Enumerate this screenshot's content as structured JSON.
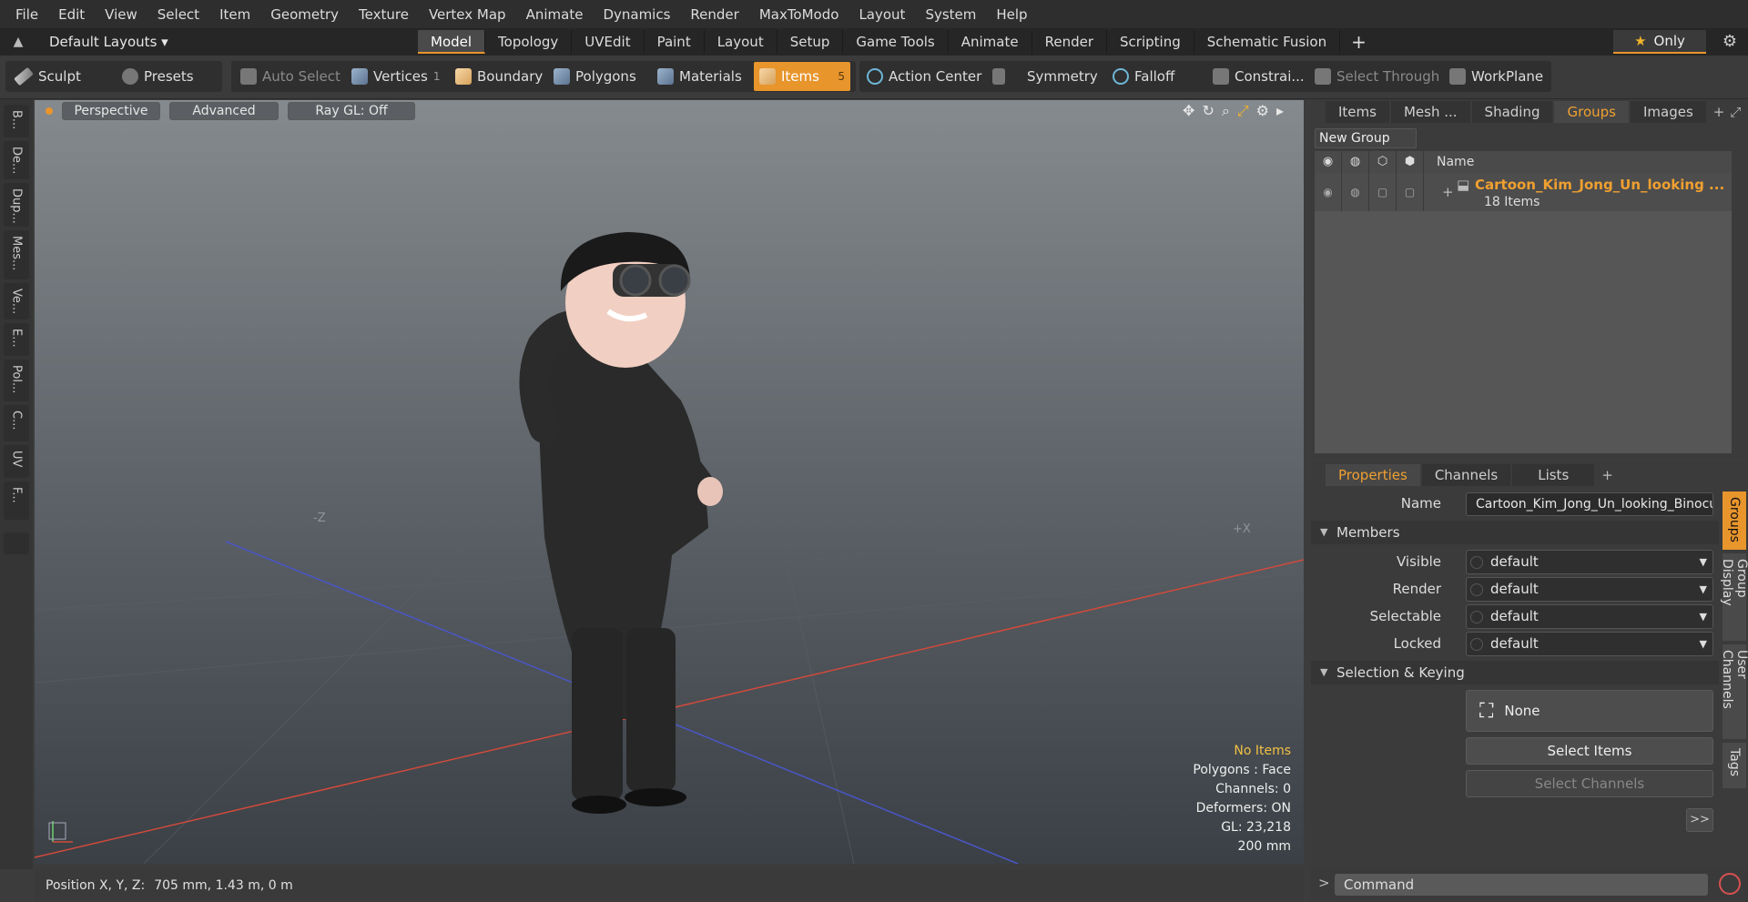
{
  "menu": [
    "File",
    "Edit",
    "View",
    "Select",
    "Item",
    "Geometry",
    "Texture",
    "Vertex Map",
    "Animate",
    "Dynamics",
    "Render",
    "MaxToModo",
    "Layout",
    "System",
    "Help"
  ],
  "layout_selector": "Default Layouts ▾",
  "tabs": [
    "Model",
    "Topology",
    "UVEdit",
    "Paint",
    "Layout",
    "Setup",
    "Game Tools",
    "Animate",
    "Render",
    "Scripting",
    "Schematic Fusion"
  ],
  "active_tab": "Model",
  "only_label": "Only",
  "toolbar": {
    "sculpt": "Sculpt",
    "presets": "Presets",
    "auto_select": "Auto Select",
    "vertices": "Vertices",
    "vertices_count": "1",
    "boundary": "Boundary",
    "polygons": "Polygons",
    "materials": "Materials",
    "items": "Items",
    "items_count": "5",
    "action_center": "Action Center",
    "symmetry": "Symmetry",
    "falloff": "Falloff",
    "constraints": "Constrai...",
    "select_through": "Select Through",
    "workplane": "WorkPlane"
  },
  "left_tabs": [
    "B...",
    "De...",
    "Dup...",
    "Mes...",
    "Ve...",
    "E...",
    "Pol...",
    "C...",
    "UV",
    "F..."
  ],
  "viewport": {
    "perspective": "Perspective",
    "advanced": "Advanced",
    "raygl": "Ray GL: Off",
    "axis_neg_z": "-Z",
    "axis_pos_x": "+X",
    "info": {
      "no_items": "No Items",
      "polygons": "Polygons : Face",
      "channels": "Channels: 0",
      "deformers": "Deformers: ON",
      "gl": "GL: 23,218",
      "scale": "200 mm"
    }
  },
  "status": {
    "label": "Position X, Y, Z:",
    "value": "705 mm, 1.43 m, 0 m"
  },
  "right_top": {
    "tabs": [
      "Items",
      "Mesh ...",
      "Shading",
      "Groups",
      "Images"
    ],
    "active_tab": "Groups",
    "new_group": "New Group",
    "col_name": "Name",
    "group_name": "Cartoon_Kim_Jong_Un_looking ...",
    "group_count": "18 Items"
  },
  "right_bottom": {
    "tabs": [
      "Properties",
      "Channels",
      "Lists"
    ],
    "active_tab": "Properties",
    "name_label": "Name",
    "name_value": "Cartoon_Kim_Jong_Un_looking_Binocu",
    "members_label": "Members",
    "visible_label": "Visible",
    "render_label": "Render",
    "selectable_label": "Selectable",
    "locked_label": "Locked",
    "default_value": "default",
    "sel_keying_label": "Selection & Keying",
    "none_label": "None",
    "select_items": "Select Items",
    "select_channels": "Select Channels",
    "more": ">>",
    "side_tabs": [
      "Groups",
      "Group Display",
      "User Channels",
      "Tags"
    ]
  },
  "command_placeholder": "Command",
  "colors": {
    "accent": "#e8952c",
    "group_text": "#f0a030",
    "no_items": "#f3c045"
  }
}
